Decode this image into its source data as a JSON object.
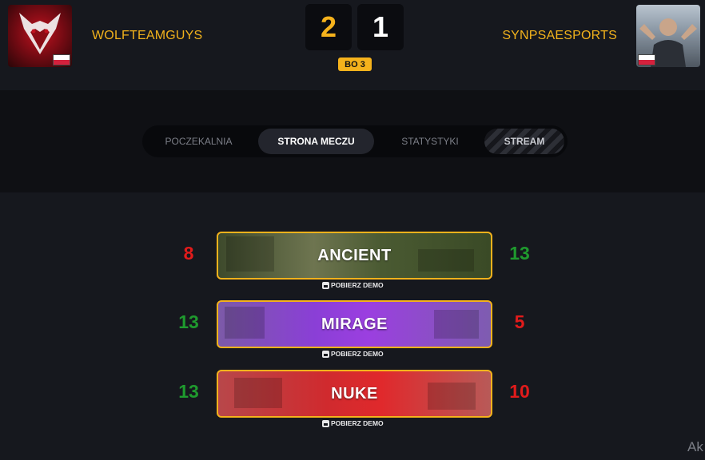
{
  "header": {
    "team_left": {
      "name": "WOLFTEAMGUYS",
      "flag": "poland-flag"
    },
    "team_right": {
      "name": "SYNPSAESPORTS",
      "flag": "poland-flag"
    },
    "score_left": "2",
    "score_right": "1",
    "format": "BO 3"
  },
  "tabs": [
    {
      "label": "POCZEKALNIA"
    },
    {
      "label": "STRONA MECZU"
    },
    {
      "label": "STATYSTYKI"
    },
    {
      "label": "STREAM"
    }
  ],
  "maps": [
    {
      "name": "ANCIENT",
      "score_left": "8",
      "score_right": "13",
      "demo_label": "POBIERZ DEMO"
    },
    {
      "name": "MIRAGE",
      "score_left": "13",
      "score_right": "5",
      "demo_label": "POBIERZ DEMO"
    },
    {
      "name": "NUKE",
      "score_left": "13",
      "score_right": "10",
      "demo_label": "POBIERZ DEMO"
    }
  ],
  "corner_text": "Ak",
  "colors": {
    "accent": "#f5b21c",
    "win": "#1f9a2e",
    "loss": "#e11b1b"
  }
}
